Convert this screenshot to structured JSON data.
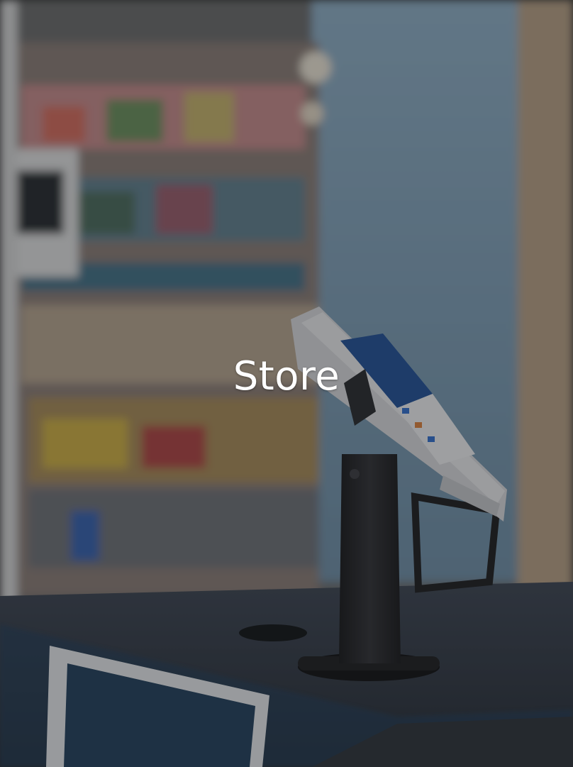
{
  "banner": {
    "title": "Store"
  },
  "colors": {
    "overlay": "#1e2024",
    "text": "#ffffff",
    "terminal_body": "#e6e6e8",
    "stand": "#1c1c1e"
  },
  "image": {
    "subject": "store-checkout-payment-terminal"
  }
}
